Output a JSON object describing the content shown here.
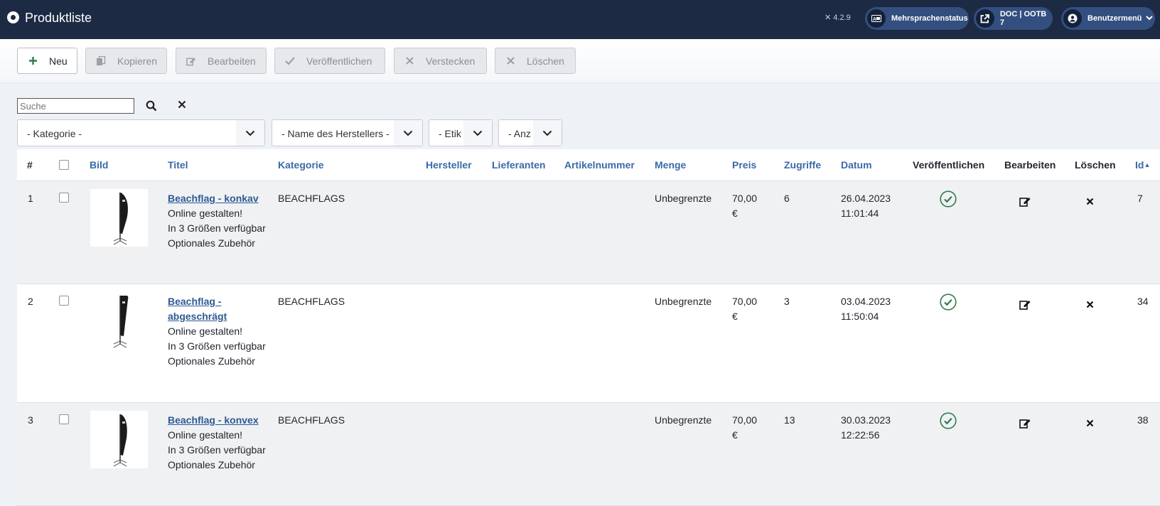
{
  "header": {
    "title": "Produktliste",
    "version": "4.2.9",
    "multilang_label": "Mehrsprachenstatus",
    "doc_label": "DOC | OOTB 7",
    "user_menu_label": "Benutzermenü"
  },
  "toolbar": {
    "new_label": "Neu",
    "copy_label": "Kopieren",
    "edit_label": "Bearbeiten",
    "publish_label": "Veröffentlichen",
    "hide_label": "Verstecken",
    "delete_label": "Löschen"
  },
  "filters": {
    "search_placeholder": "Suche",
    "category": "- Kategorie -",
    "manufacturer": "- Name des Herstellers -",
    "tag": "- Etik",
    "count": "- Anz"
  },
  "table": {
    "headers": {
      "num": "#",
      "image": "Bild",
      "title": "Titel",
      "category": "Kategorie",
      "manufacturer": "Hersteller",
      "suppliers": "Lieferanten",
      "article_number": "Artikelnummer",
      "quantity": "Menge",
      "price": "Preis",
      "hits": "Zugriffe",
      "date": "Datum",
      "published": "Veröffentlichen",
      "edit": "Bearbeiten",
      "delete": "Löschen",
      "id": "Id"
    },
    "rows": [
      {
        "num": "1",
        "title": "Beachflag - konkav",
        "desc1": "Online gestalten!",
        "desc2": "In 3 Größen verfügbar",
        "desc3": "Optionales Zubehör",
        "category": "BEACHFLAGS",
        "quantity": "Unbegrenzte",
        "price_amount": "70,00",
        "price_currency": "€",
        "hits": "6",
        "date": "26.04.2023",
        "time": "11:01:44",
        "id": "7"
      },
      {
        "num": "2",
        "title": "Beachflag - abgeschrägt",
        "desc1": "Online gestalten!",
        "desc2": "In 3 Größen verfügbar",
        "desc3": "Optionales Zubehör",
        "category": "BEACHFLAGS",
        "quantity": "Unbegrenzte",
        "price_amount": "70,00",
        "price_currency": "€",
        "hits": "3",
        "date": "03.04.2023",
        "time": "11:50:04",
        "id": "34"
      },
      {
        "num": "3",
        "title": "Beachflag - konvex",
        "desc1": "Online gestalten!",
        "desc2": "In 3 Größen verfügbar",
        "desc3": "Optionales Zubehör",
        "category": "BEACHFLAGS",
        "quantity": "Unbegrenzte",
        "price_amount": "70,00",
        "price_currency": "€",
        "hits": "13",
        "date": "30.03.2023",
        "time": "12:22:56",
        "id": "38"
      }
    ]
  },
  "colors": {
    "header_bg": "#1c2a44",
    "link": "#3a6aa8",
    "published_green": "#2f7a4f"
  }
}
